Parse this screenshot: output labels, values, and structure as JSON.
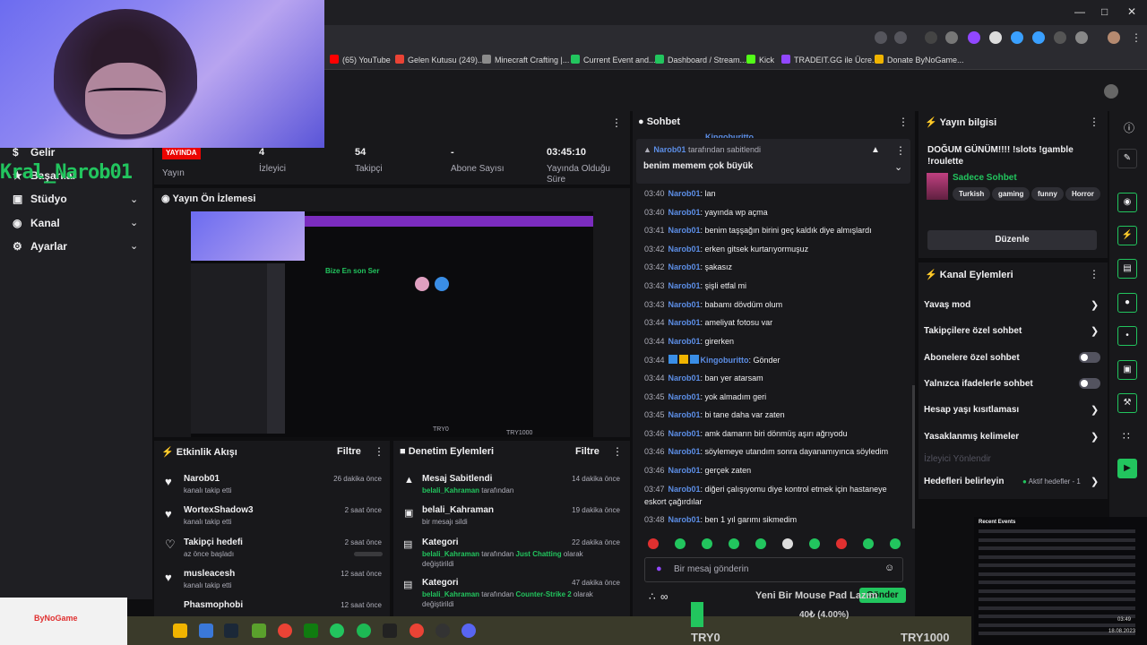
{
  "bookmarks": [
    {
      "label": "(65) YouTube",
      "color": "#ff0000"
    },
    {
      "label": "Gelen Kutusu (249)...",
      "color": "#ea4335"
    },
    {
      "label": "Minecraft Crafting |...",
      "color": "#8b8b8b"
    },
    {
      "label": "Current Event and...",
      "color": "#22c55e"
    },
    {
      "label": "Dashboard / Stream...",
      "color": "#22c55e"
    },
    {
      "label": "Kick",
      "color": "#53fc18"
    },
    {
      "label": "TRADEIT.GG ile Ücre...",
      "color": "#9147ff"
    },
    {
      "label": "Donate ByNoGame...",
      "color": "#f0b400"
    }
  ],
  "nav": {
    "brand": "Kral_Narob01",
    "items": [
      {
        "label": "Gelir"
      },
      {
        "label": "Başarılar"
      },
      {
        "label": "Stüdyo"
      },
      {
        "label": "Kanal"
      },
      {
        "label": "Ayarlar"
      }
    ]
  },
  "stats": {
    "live_badge": "YAYINDA",
    "items": [
      {
        "value": "",
        "label": "Yayın"
      },
      {
        "value": "4",
        "label": "İzleyici"
      },
      {
        "value": "54",
        "label": "Takipçi"
      },
      {
        "value": "-",
        "label": "Abone Sayısı"
      },
      {
        "value": "03:45:10",
        "label": "Yayında Olduğu Süre"
      }
    ]
  },
  "preview": {
    "title": "Yayın Ön İzlemesi",
    "overlay_text": "Bize En son Ser",
    "bottom_left": "TRY0",
    "bottom_right": "TRY1000"
  },
  "activity": {
    "title": "Etkinlik Akışı",
    "filter": "Filtre",
    "items": [
      {
        "name": "Narob01",
        "sub": "kanalı takip etti",
        "time": "26 dakika önce"
      },
      {
        "name": "WortexShadow3",
        "sub": "kanalı takip etti",
        "time": "2 saat önce"
      },
      {
        "name": "Takipçi hedefi",
        "sub": "az önce başladı",
        "time": "2 saat önce"
      },
      {
        "name": "musleacesh",
        "sub": "kanalı takip etti",
        "time": "12 saat önce"
      },
      {
        "name": "Phasmophobi",
        "sub": "",
        "time": "12 saat önce"
      }
    ]
  },
  "moderation": {
    "title": "Denetim Eylemleri",
    "filter": "Filtre",
    "items": [
      {
        "name": "Mesaj Sabitlendi",
        "user": "belali_Kahraman",
        "rest": " tarafından",
        "extra": "",
        "line2": "",
        "time": "14 dakika önce"
      },
      {
        "name": "belali_Kahraman",
        "user": "",
        "rest": "bir mesajı sildi",
        "extra": "",
        "line2": "",
        "time": "19 dakika önce"
      },
      {
        "name": "Kategori",
        "user": "belali_Kahraman",
        "rest": " tarafından ",
        "extra": "Just Chatting",
        "extra_rest": " olarak",
        "line2": "değiştirildi",
        "time": "22 dakika önce"
      },
      {
        "name": "Kategori",
        "user": "belali_Kahraman",
        "rest": " tarafından ",
        "extra": "Counter-Strike 2",
        "extra_rest": " olarak",
        "line2": "değiştirildi",
        "time": "47 dakika önce"
      }
    ]
  },
  "chat": {
    "title": "Sohbet",
    "pinned_by_user": "Narob01",
    "pinned_by_suffix": " tarafından sabitlendi",
    "pinned_msg": "benim memem çok büyük",
    "top_user": "Kingoburitto",
    "messages": [
      {
        "time": "03:40",
        "user": "Narob01",
        "text": ": lan"
      },
      {
        "time": "03:40",
        "user": "Narob01",
        "text": ": yayında wp açma"
      },
      {
        "time": "03:41",
        "user": "Narob01",
        "text": ": benim taşşağın birini geç kaldık diye almışlardı"
      },
      {
        "time": "03:42",
        "user": "Narob01",
        "text": ": erken gitsek kurtarıyormuşuz"
      },
      {
        "time": "03:42",
        "user": "Narob01",
        "text": ": şakasız"
      },
      {
        "time": "03:43",
        "user": "Narob01",
        "text": ": şişli etfal mi"
      },
      {
        "time": "03:43",
        "user": "Narob01",
        "text": ": babamı dövdüm olum"
      },
      {
        "time": "03:44",
        "user": "Narob01",
        "text": ": ameliyat fotosu var"
      },
      {
        "time": "03:44",
        "user": "Narob01",
        "text": ": girerken"
      },
      {
        "time": "03:44",
        "user": "Kingoburitto",
        "text": ": Gönder",
        "badges": true
      },
      {
        "time": "03:44",
        "user": "Narob01",
        "text": ": ban yer atarsam"
      },
      {
        "time": "03:45",
        "user": "Narob01",
        "text": ": yok almadım geri"
      },
      {
        "time": "03:45",
        "user": "Narob01",
        "text": ": bi tane daha var zaten"
      },
      {
        "time": "03:46",
        "user": "Narob01",
        "text": ": amk damarın biri dönmüş aşırı ağrıyodu"
      },
      {
        "time": "03:46",
        "user": "Narob01",
        "text": ": söylemeye utandım sonra dayanamıyınca söyledim"
      },
      {
        "time": "03:46",
        "user": "Narob01",
        "text": ": gerçek zaten"
      },
      {
        "time": "03:47",
        "user": "Narob01",
        "text": ": diğeri çalışıyomu diye kontrol etmek için hastaneye",
        "line2": "eskort çağırdılar"
      },
      {
        "time": "03:48",
        "user": "Narob01",
        "text": ": ben 1 yıl garımı sikmedim"
      }
    ],
    "input_placeholder": "Bir mesaj gönderin",
    "send_label": "Gönder"
  },
  "stream_info": {
    "title": "Yayın bilgisi",
    "stream_title": "DOĞUM GÜNÜM!!!! !slots !gamble !roulette",
    "category": "Sadece Sohbet",
    "tags": [
      "Turkish",
      "gaming",
      "funny",
      "Horror"
    ],
    "edit_label": "Düzenle"
  },
  "channel_actions": {
    "title": "Kanal Eylemleri",
    "items": [
      {
        "label": "Yavaş mod",
        "kind": "arrow"
      },
      {
        "label": "Takipçilere özel sohbet",
        "kind": "arrow"
      },
      {
        "label": "Abonelere özel sohbet",
        "kind": "toggle"
      },
      {
        "label": "Yalnızca ifadelerle sohbet",
        "kind": "toggle"
      },
      {
        "label": "Hesap yaşı kısıtlaması",
        "kind": "arrow"
      },
      {
        "label": "Yasaklanmış kelimeler",
        "kind": "arrow"
      },
      {
        "label": "İzleyici Yönlendir",
        "kind": "disabled"
      },
      {
        "label": "Hedefleri belirleyin",
        "kind": "arrow"
      }
    ],
    "goal_status": "Aktif hedefler - 1"
  },
  "overlay": {
    "goal_text": "Yeni Bir Mouse Pad Lazım",
    "goal_amount": "40₺ (4.00%)",
    "goal_fraction": 0.04,
    "try0": "TRY0",
    "try1000": "TRY1000",
    "logo": "ByNoGame",
    "recent_events_title": "Recent Events",
    "clock_time": "03:49",
    "clock_date": "18.08.2023"
  },
  "colors": {
    "accent": "#22c55e",
    "live": "#eb0400",
    "username": "#5c8ee6"
  }
}
